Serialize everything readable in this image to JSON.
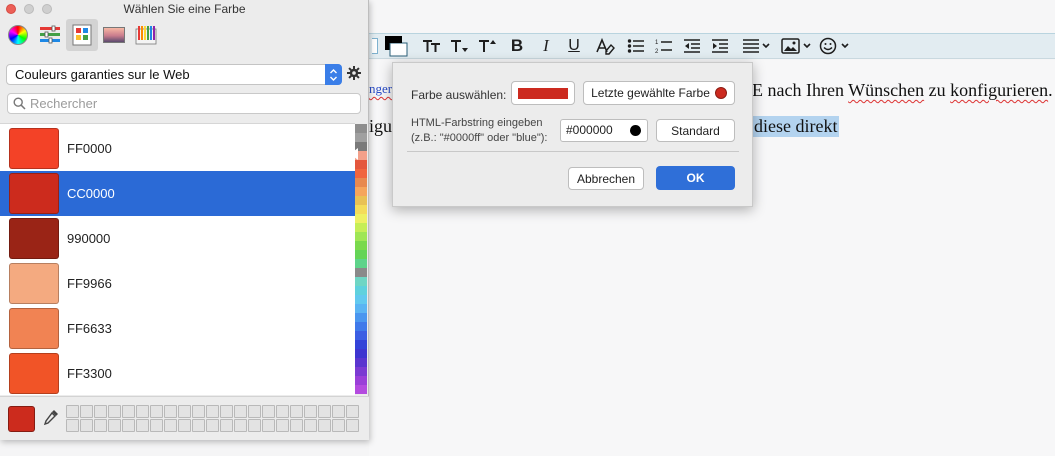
{
  "panel": {
    "title": "Wählen Sie eine Farbe",
    "list_name": "Couleurs garanties sur le Web",
    "search_placeholder": "Rechercher",
    "colors": [
      {
        "name": "FF0000",
        "hex": "#f34227",
        "selected": false
      },
      {
        "name": "CC0000",
        "hex": "#cc2b1d",
        "selected": true
      },
      {
        "name": "990000",
        "hex": "#9a2416",
        "selected": false
      },
      {
        "name": "FF9966",
        "hex": "#f4aa80",
        "selected": false
      },
      {
        "name": "FF6633",
        "hex": "#f18353",
        "selected": false
      },
      {
        "name": "FF3300",
        "hex": "#f15427",
        "selected": false
      }
    ],
    "current_color": "#cc2b1d",
    "selection_color": "#2b6ad6"
  },
  "dialog": {
    "farbe_label": "Farbe auswählen:",
    "last_color_button": "Letzte gewählte Farbe",
    "html_label_line1": "HTML-Farbstring eingeben",
    "html_label_line2": "(z.B.: \"#0000ff\" oder \"blue\"):",
    "html_value": "#000000",
    "standard_button": "Standard",
    "cancel_button": "Abbrechen",
    "ok_button": "OK"
  },
  "document": {
    "line1_left": "nger",
    "line1_right_a": "E nach Ihren",
    "line1_right_b": "Wünschen",
    "line1_right_c": " zu ",
    "line1_right_d": "konfigurieren",
    "line1_right_e": ".",
    "line2_left": "igu",
    "line2_right": "diese direkt"
  }
}
